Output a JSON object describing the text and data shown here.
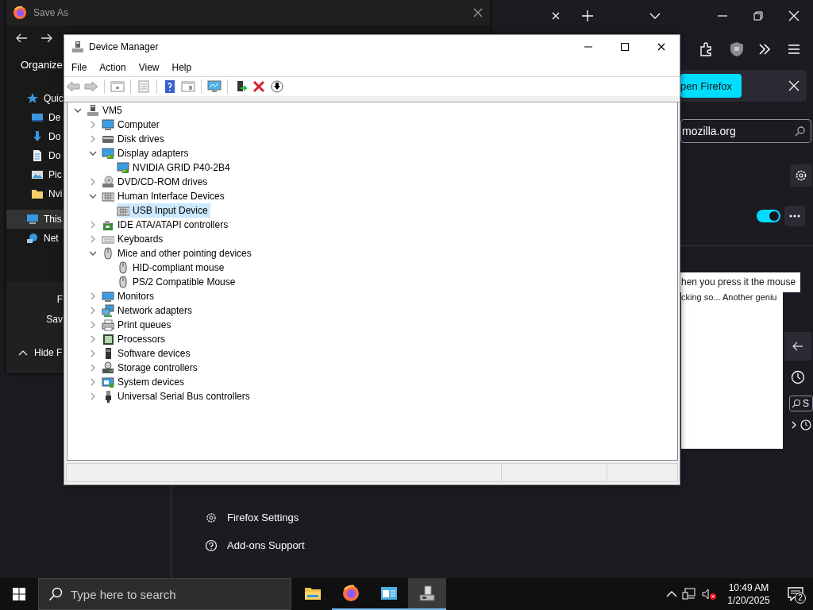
{
  "firefox": {
    "notification": {
      "button": "pen Firefox"
    },
    "search": {
      "value": "mozilla.org"
    },
    "extension_toggle": {
      "on": true
    },
    "review_text": [
      "hen you press it the mouse",
      "cking so... Another geniu"
    ],
    "side_panel": {
      "search": "S"
    },
    "footer_links": [
      {
        "kind": "settings",
        "label": "Firefox Settings"
      },
      {
        "kind": "help",
        "label": "Add-ons Support"
      }
    ]
  },
  "save_as": {
    "title": "Save As",
    "toolbar": "Organize",
    "sidebar": [
      {
        "kind": "star",
        "label": "Quic",
        "selected": false,
        "children": [
          {
            "kind": "desktop",
            "label": "De",
            "selected": false
          },
          {
            "kind": "download",
            "label": "Do",
            "selected": false
          },
          {
            "kind": "document",
            "label": "Do",
            "selected": false
          },
          {
            "kind": "picture",
            "label": "Pic",
            "selected": false
          },
          {
            "kind": "folder",
            "label": "Nvi",
            "selected": false
          }
        ]
      },
      {
        "kind": "pc",
        "label": "This",
        "selected": true
      },
      {
        "kind": "network",
        "label": "Net",
        "selected": false
      }
    ],
    "fields": [
      "F",
      "Sav"
    ],
    "hide_folders": "Hide F"
  },
  "device_manager": {
    "title": "Device Manager",
    "menu": [
      "File",
      "Action",
      "View",
      "Help"
    ],
    "tree": [
      {
        "kind": "root",
        "label": "VM5",
        "expanded": true,
        "selected": false,
        "children": [
          {
            "kind": "computer",
            "label": "Computer",
            "expanded": false,
            "selected": false
          },
          {
            "kind": "disk",
            "label": "Disk drives",
            "expanded": false,
            "selected": false
          },
          {
            "kind": "display",
            "label": "Display adapters",
            "expanded": true,
            "selected": false,
            "children": [
              {
                "kind": "display",
                "label": "NVIDIA GRID P40-2B4",
                "selected": false
              }
            ]
          },
          {
            "kind": "dvd",
            "label": "DVD/CD-ROM drives",
            "expanded": false,
            "selected": false
          },
          {
            "kind": "hid",
            "label": "Human Interface Devices",
            "expanded": true,
            "selected": false,
            "children": [
              {
                "kind": "hid",
                "label": "USB Input Device",
                "selected": true
              }
            ]
          },
          {
            "kind": "ide",
            "label": "IDE ATA/ATAPI controllers",
            "expanded": false,
            "selected": false
          },
          {
            "kind": "keyboard",
            "label": "Keyboards",
            "expanded": false,
            "selected": false
          },
          {
            "kind": "mouse",
            "label": "Mice and other pointing devices",
            "expanded": true,
            "selected": false,
            "children": [
              {
                "kind": "mouse",
                "label": "HID-compliant mouse",
                "selected": false
              },
              {
                "kind": "mouse",
                "label": "PS/2 Compatible Mouse",
                "selected": false
              }
            ]
          },
          {
            "kind": "monitor",
            "label": "Monitors",
            "expanded": false,
            "selected": false
          },
          {
            "kind": "network",
            "label": "Network adapters",
            "expanded": false,
            "selected": false
          },
          {
            "kind": "printer",
            "label": "Print queues",
            "expanded": false,
            "selected": false
          },
          {
            "kind": "processor",
            "label": "Processors",
            "expanded": false,
            "selected": false
          },
          {
            "kind": "software",
            "label": "Software devices",
            "expanded": false,
            "selected": false
          },
          {
            "kind": "storage",
            "label": "Storage controllers",
            "expanded": false,
            "selected": false
          },
          {
            "kind": "system",
            "label": "System devices",
            "expanded": false,
            "selected": false
          },
          {
            "kind": "usb",
            "label": "Universal Serial Bus controllers",
            "expanded": false,
            "selected": false
          }
        ]
      }
    ]
  },
  "taskbar": {
    "search_placeholder": "Type here to search",
    "apps": [
      {
        "kind": "explorer",
        "running": false,
        "active": false
      },
      {
        "kind": "browser",
        "running": true,
        "active": false
      },
      {
        "kind": "window",
        "running": true,
        "active": false
      },
      {
        "kind": "devices",
        "running": true,
        "active": true
      }
    ],
    "clock": {
      "time": "10:49 AM",
      "date": "1/20/2025"
    },
    "notifications": "2"
  }
}
